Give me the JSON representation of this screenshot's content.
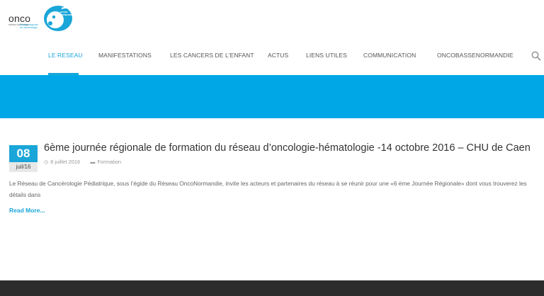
{
  "logo": {
    "text": "onco",
    "tag": "BASSE NORMANDIE",
    "sub_left": "réseau d'oncologie",
    "sub_right": "Réseau régional de cancérologie"
  },
  "nav": {
    "items": [
      {
        "label": "LE RESEAU",
        "active": true
      },
      {
        "label": "MANIFESTATIONS"
      },
      {
        "label": "LES CANCERS DE L'ENFANT"
      },
      {
        "label": "ACTUS"
      },
      {
        "label": "LIENS UTILES"
      },
      {
        "label": "COMMUNICATION"
      },
      {
        "label": "ONCOBASSENORMANDIE"
      }
    ],
    "accent": "#1aa6d8"
  },
  "banner": {
    "color": "#00a7e6"
  },
  "post": {
    "day": "08",
    "month": "juil/16",
    "title": "6ème journée régionale de formation du réseau d’oncologie-hématologie -14 octobre 2016 – CHU de Caen",
    "date": "8 juillet 2016",
    "category": "Formation",
    "excerpt": "Le Réseau de Cancérologie Pédiatrique, sous l’égide du Réseau OncoNormandie, invite les acteurs et partenaires du réseau à se réunir pour une «6 ème Journée Régionale» dont vous trouverez les détails dans",
    "read_more": "Read More..."
  }
}
